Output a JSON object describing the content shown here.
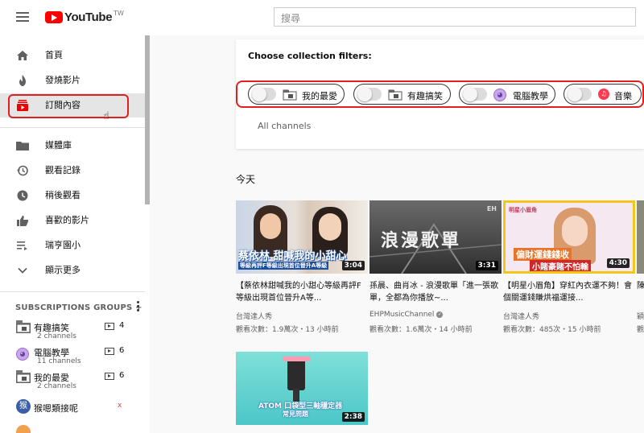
{
  "header": {
    "logo_text": "YouTube",
    "logo_region": "TW",
    "search_placeholder": "搜尋"
  },
  "sidebar": {
    "items": [
      {
        "label": "首頁",
        "icon": "home-icon"
      },
      {
        "label": "發燒影片",
        "icon": "flame-icon"
      },
      {
        "label": "訂閱內容",
        "icon": "subscriptions-icon",
        "active": true
      },
      {
        "label": "媒體庫",
        "icon": "folder-icon"
      },
      {
        "label": "觀看記錄",
        "icon": "history-icon"
      },
      {
        "label": "稍後觀看",
        "icon": "clock-icon"
      },
      {
        "label": "喜歡的影片",
        "icon": "thumbs-up-icon"
      },
      {
        "label": "瑞亨園小",
        "icon": "playlist-icon"
      },
      {
        "label": "顯示更多",
        "icon": "chevron-down-icon"
      }
    ],
    "subscription_groups": {
      "header": "SUBSCRIPTIONS GROUPS +",
      "groups": [
        {
          "name": "有趣搞笑",
          "sub": "2 channels",
          "count": "4",
          "icon": "folder-icon"
        },
        {
          "name": "電腦教學",
          "sub": "11 channels",
          "count": "6",
          "icon": "brain-icon"
        },
        {
          "name": "我的最愛",
          "sub": "2 channels",
          "count": "6",
          "icon": "folder-icon"
        }
      ],
      "channel_avatar_text": "猴",
      "channel_name": "猴嗯類接呢",
      "channel_close": "x"
    }
  },
  "filters": {
    "title": "Choose collection filters:",
    "chips": [
      {
        "label": "我的最愛",
        "icon": "folder-icon"
      },
      {
        "label": "有趣搞笑",
        "icon": "folder-icon"
      },
      {
        "label": "電腦教學",
        "icon": "brain-icon"
      },
      {
        "label": "音樂",
        "icon": "music-icon"
      }
    ],
    "all_channels": "All channels"
  },
  "feed": {
    "section_title": "今天",
    "videos": [
      {
        "title": "【蔡依林甜喊我的小甜心等級再評F等級出現首位晉升A等...",
        "channel": "台灣達人秀",
        "meta": "觀看次數：1.9萬次・13 小時前",
        "duration": "3:04",
        "caption_main": "蔡依林 甜喊我的小甜心",
        "caption_sub": "等級再評F等級出現首位晉升A等級"
      },
      {
        "title": "孫晨、曲肖冰 - 浪漫歌單「進一張歌單，全都為你播放~...",
        "channel": "EHPMusicChannel",
        "meta": "觀看次數：1.6萬次・14 小時前",
        "duration": "3:31",
        "caption_main": "浪漫歌單",
        "caption_sub": "EH"
      },
      {
        "title": "【明星小眉角】穿紅內衣運不夠！會個關運錢賺烘福運接...",
        "channel": "台灣達人秀",
        "meta": "觀看次數：485次・15 小時前",
        "duration": "4:30",
        "caption_main": "偏財運錢錢收",
        "caption_sub": "小賭豪賭不怕輸",
        "caption_corner": "明星小眉角"
      },
      {
        "title": "陳...",
        "channel": "穎",
        "meta": "觀",
        "duration": "",
        "caption_main": ""
      },
      {
        "title": "",
        "channel": "",
        "meta": "",
        "duration": "2:38",
        "caption_main": "ATOM 口袋型三軸穩定器",
        "caption_sub": "常見問題"
      }
    ]
  },
  "colors": {
    "brand_red": "#ff0000",
    "highlight_red": "#e02020",
    "active_bg": "#e5e5e5"
  }
}
